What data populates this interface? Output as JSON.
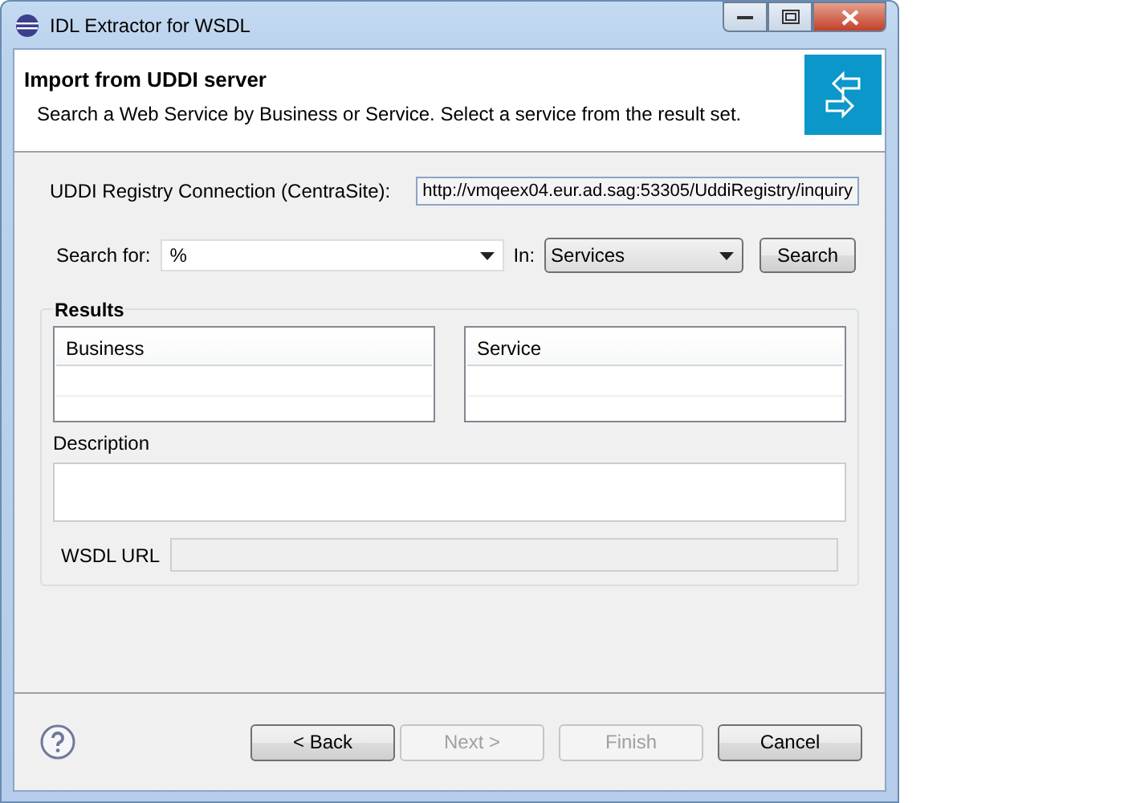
{
  "window": {
    "title": "IDL Extractor for WSDL"
  },
  "header": {
    "title": "Import from UDDI server",
    "description": "Search a Web Service by Business or Service. Select a service from the result set."
  },
  "connection": {
    "label": "UDDI Registry Connection (CentraSite):",
    "value": "http://vmqeex04.eur.ad.sag:53305/UddiRegistry/inquiry"
  },
  "search": {
    "label": "Search for:",
    "value": "%",
    "in_label": "In:",
    "in_value": "Services",
    "button": "Search"
  },
  "results": {
    "title": "Results",
    "tables": [
      {
        "column": "Business"
      },
      {
        "column": "Service"
      }
    ],
    "description_label": "Description",
    "wsdl_label": "WSDL URL"
  },
  "buttons": [
    {
      "label": "< Back",
      "disabled": false
    },
    {
      "label": "Next >",
      "disabled": true
    },
    {
      "label": "Finish",
      "disabled": true
    },
    {
      "label": "Cancel",
      "disabled": false
    }
  ]
}
